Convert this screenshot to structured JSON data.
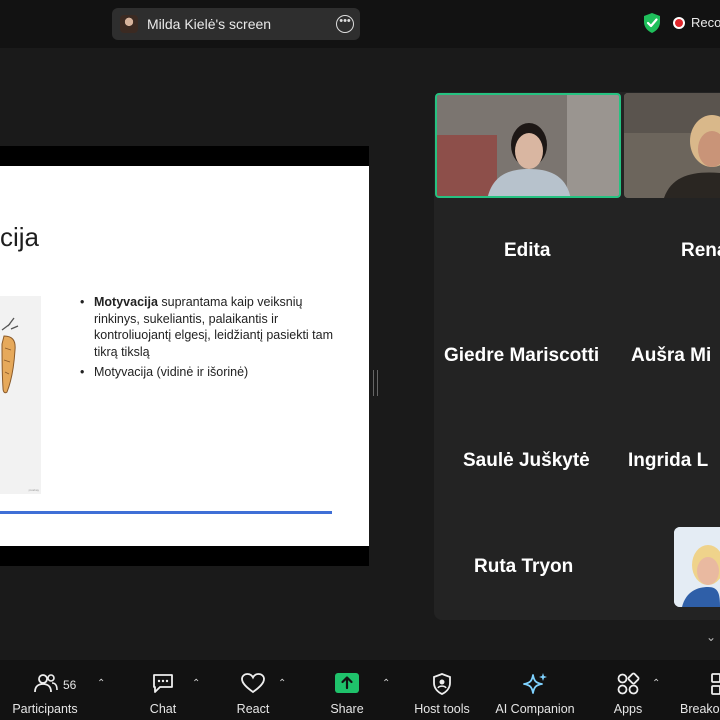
{
  "topbar": {
    "screen_share_label": "Milda Kielė's screen",
    "more_icon": "more-options-icon",
    "security_icon": "shield-check-icon",
    "recording_label": "Recording"
  },
  "slide": {
    "title": "cija",
    "bullet1_bold": "Motyvacija",
    "bullet1_rest": " suprantama kaip veiksnių rinkinys, sukeliantis, palaikantis ir kontroliuojantį elgesį, leidžiantį pasiekti tam tikrą tikslą",
    "bullet2": "Motyvacija (vidinė ir išorinė)",
    "accent_color": "#3f6fd6"
  },
  "gallery": {
    "participants": [
      {
        "name": "Edita"
      },
      {
        "name": "Renata"
      },
      {
        "name": "Giedre Mariscotti"
      },
      {
        "name": "Aušra Mi"
      },
      {
        "name": "Saulė Juškytė"
      },
      {
        "name": "Ingrida L"
      },
      {
        "name": "Ruta Tryon"
      }
    ],
    "active_speaker_color": "#26c281"
  },
  "toolbar": {
    "participants_label": "Participants",
    "participants_count": "56",
    "chat_label": "Chat",
    "react_label": "React",
    "share_label": "Share",
    "share_color": "#1fc26b",
    "host_tools_label": "Host tools",
    "ai_companion_label": "AI Companion",
    "apps_label": "Apps",
    "breakout_label": "Breakout rooms"
  }
}
